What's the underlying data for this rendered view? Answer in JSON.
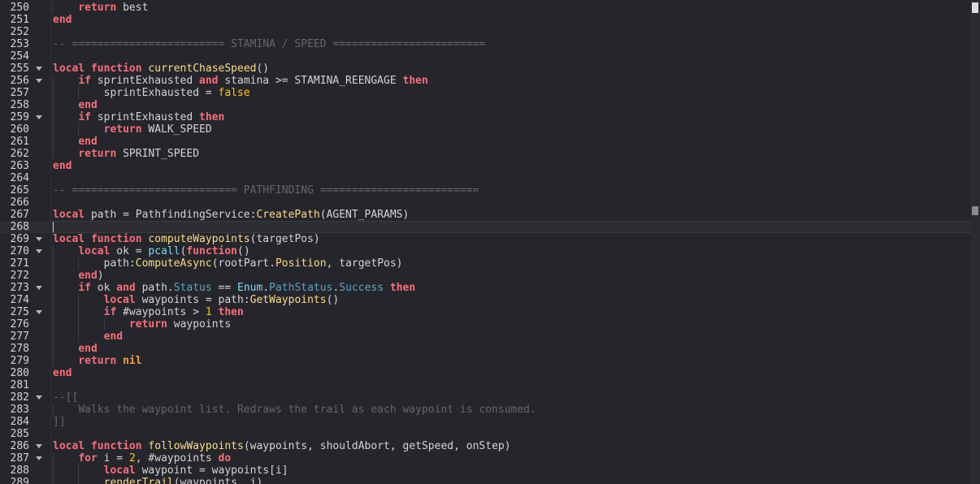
{
  "lines": [
    {
      "n": "250",
      "fold": false,
      "indent": 1,
      "tokens": [
        [
          "kw",
          "return"
        ],
        [
          "op",
          " best"
        ]
      ]
    },
    {
      "n": "251",
      "fold": false,
      "indent": 0,
      "tokens": [
        [
          "kw",
          "end"
        ]
      ]
    },
    {
      "n": "252",
      "fold": false,
      "indent": 0,
      "tokens": []
    },
    {
      "n": "253",
      "fold": false,
      "indent": 0,
      "tokens": [
        [
          "cm",
          "-- ======================== STAMINA / SPEED ========================"
        ]
      ]
    },
    {
      "n": "254",
      "fold": false,
      "indent": 0,
      "tokens": []
    },
    {
      "n": "255",
      "fold": true,
      "indent": 0,
      "tokens": [
        [
          "kw",
          "local"
        ],
        [
          "op",
          " "
        ],
        [
          "kw",
          "function"
        ],
        [
          "op",
          " "
        ],
        [
          "fn",
          "currentChaseSpeed"
        ],
        [
          "op",
          "()"
        ]
      ]
    },
    {
      "n": "256",
      "fold": true,
      "indent": 1,
      "tokens": [
        [
          "kw",
          "if"
        ],
        [
          "op",
          " sprintExhausted "
        ],
        [
          "kw",
          "and"
        ],
        [
          "op",
          " stamina >= STAMINA_REENGAGE "
        ],
        [
          "kw",
          "then"
        ]
      ]
    },
    {
      "n": "257",
      "fold": false,
      "indent": 2,
      "tokens": [
        [
          "op",
          "sprintExhausted = "
        ],
        [
          "num",
          "false"
        ]
      ]
    },
    {
      "n": "258",
      "fold": false,
      "indent": 1,
      "tokens": [
        [
          "kw",
          "end"
        ]
      ]
    },
    {
      "n": "259",
      "fold": true,
      "indent": 1,
      "tokens": [
        [
          "kw",
          "if"
        ],
        [
          "op",
          " sprintExhausted "
        ],
        [
          "kw",
          "then"
        ]
      ]
    },
    {
      "n": "260",
      "fold": false,
      "indent": 2,
      "tokens": [
        [
          "kw",
          "return"
        ],
        [
          "op",
          " WALK_SPEED"
        ]
      ]
    },
    {
      "n": "261",
      "fold": false,
      "indent": 1,
      "tokens": [
        [
          "kw",
          "end"
        ]
      ]
    },
    {
      "n": "262",
      "fold": false,
      "indent": 1,
      "tokens": [
        [
          "kw",
          "return"
        ],
        [
          "op",
          " SPRINT_SPEED"
        ]
      ]
    },
    {
      "n": "263",
      "fold": false,
      "indent": 0,
      "tokens": [
        [
          "kw",
          "end"
        ]
      ]
    },
    {
      "n": "264",
      "fold": false,
      "indent": 0,
      "tokens": []
    },
    {
      "n": "265",
      "fold": false,
      "indent": 0,
      "tokens": [
        [
          "cm",
          "-- ========================== PATHFINDING ========================="
        ]
      ]
    },
    {
      "n": "266",
      "fold": false,
      "indent": 0,
      "tokens": []
    },
    {
      "n": "267",
      "fold": false,
      "indent": 0,
      "tokens": [
        [
          "kw",
          "local"
        ],
        [
          "op",
          " path = PathfindingService:"
        ],
        [
          "fn",
          "CreatePath"
        ],
        [
          "op",
          "(AGENT_PARAMS)"
        ]
      ]
    },
    {
      "n": "268",
      "fold": false,
      "indent": 0,
      "current": true,
      "tokens": []
    },
    {
      "n": "269",
      "fold": true,
      "indent": 0,
      "tokens": [
        [
          "kw",
          "local"
        ],
        [
          "op",
          " "
        ],
        [
          "kw",
          "function"
        ],
        [
          "op",
          " "
        ],
        [
          "fn",
          "computeWaypoints"
        ],
        [
          "op",
          "(targetPos)"
        ]
      ]
    },
    {
      "n": "270",
      "fold": true,
      "indent": 1,
      "tokens": [
        [
          "kw",
          "local"
        ],
        [
          "op",
          " ok = "
        ],
        [
          "gl",
          "pcall"
        ],
        [
          "op",
          "("
        ],
        [
          "kw",
          "function"
        ],
        [
          "op",
          "()"
        ]
      ]
    },
    {
      "n": "271",
      "fold": false,
      "indent": 2,
      "tokens": [
        [
          "op",
          "path:"
        ],
        [
          "fn",
          "ComputeAsync"
        ],
        [
          "op",
          "(rootPart."
        ],
        [
          "fn",
          "Position"
        ],
        [
          "op",
          ", targetPos)"
        ]
      ]
    },
    {
      "n": "272",
      "fold": false,
      "indent": 1,
      "tokens": [
        [
          "kw",
          "end"
        ],
        [
          "op",
          ")"
        ]
      ]
    },
    {
      "n": "273",
      "fold": true,
      "indent": 1,
      "tokens": [
        [
          "kw",
          "if"
        ],
        [
          "op",
          " ok "
        ],
        [
          "kw",
          "and"
        ],
        [
          "op",
          " path."
        ],
        [
          "prop",
          "Status"
        ],
        [
          "op",
          " == "
        ],
        [
          "gl",
          "Enum"
        ],
        [
          "op",
          "."
        ],
        [
          "prop",
          "PathStatus"
        ],
        [
          "op",
          "."
        ],
        [
          "prop",
          "Success"
        ],
        [
          "op",
          " "
        ],
        [
          "kw",
          "then"
        ]
      ]
    },
    {
      "n": "274",
      "fold": false,
      "indent": 2,
      "tokens": [
        [
          "kw",
          "local"
        ],
        [
          "op",
          " waypoints = path:"
        ],
        [
          "fn",
          "GetWaypoints"
        ],
        [
          "op",
          "()"
        ]
      ]
    },
    {
      "n": "275",
      "fold": true,
      "indent": 2,
      "tokens": [
        [
          "kw",
          "if"
        ],
        [
          "op",
          " #waypoints > "
        ],
        [
          "num",
          "1"
        ],
        [
          "op",
          " "
        ],
        [
          "kw",
          "then"
        ]
      ]
    },
    {
      "n": "276",
      "fold": false,
      "indent": 3,
      "tokens": [
        [
          "kw",
          "return"
        ],
        [
          "op",
          " waypoints"
        ]
      ]
    },
    {
      "n": "277",
      "fold": false,
      "indent": 2,
      "tokens": [
        [
          "kw",
          "end"
        ]
      ]
    },
    {
      "n": "278",
      "fold": false,
      "indent": 1,
      "tokens": [
        [
          "kw",
          "end"
        ]
      ]
    },
    {
      "n": "279",
      "fold": false,
      "indent": 1,
      "tokens": [
        [
          "kw",
          "return"
        ],
        [
          "op",
          " "
        ],
        [
          "bi",
          "nil"
        ]
      ]
    },
    {
      "n": "280",
      "fold": false,
      "indent": 0,
      "tokens": [
        [
          "kw",
          "end"
        ]
      ]
    },
    {
      "n": "281",
      "fold": false,
      "indent": 0,
      "tokens": []
    },
    {
      "n": "282",
      "fold": true,
      "indent": 0,
      "tokens": [
        [
          "cm",
          "--[["
        ]
      ]
    },
    {
      "n": "283",
      "fold": false,
      "indent": 1,
      "tokens": [
        [
          "cm",
          "Walks the waypoint list. Redraws the trail as each waypoint is consumed."
        ]
      ]
    },
    {
      "n": "284",
      "fold": false,
      "indent": 0,
      "tokens": [
        [
          "cm",
          "]]"
        ]
      ]
    },
    {
      "n": "285",
      "fold": false,
      "indent": 0,
      "tokens": []
    },
    {
      "n": "286",
      "fold": true,
      "indent": 0,
      "tokens": [
        [
          "kw",
          "local"
        ],
        [
          "op",
          " "
        ],
        [
          "kw",
          "function"
        ],
        [
          "op",
          " "
        ],
        [
          "fn",
          "followWaypoints"
        ],
        [
          "op",
          "(waypoints, shouldAbort, getSpeed, onStep)"
        ]
      ]
    },
    {
      "n": "287",
      "fold": true,
      "indent": 1,
      "tokens": [
        [
          "kw",
          "for"
        ],
        [
          "op",
          " i = "
        ],
        [
          "num",
          "2"
        ],
        [
          "op",
          ", #waypoints "
        ],
        [
          "kw",
          "do"
        ]
      ]
    },
    {
      "n": "288",
      "fold": false,
      "indent": 2,
      "tokens": [
        [
          "kw",
          "local"
        ],
        [
          "op",
          " waypoint = waypoints[i]"
        ]
      ]
    },
    {
      "n": "289",
      "fold": false,
      "indent": 2,
      "tokens": [
        [
          "fn",
          "renderTrail"
        ],
        [
          "op",
          "(waypoints, i)"
        ]
      ]
    }
  ]
}
